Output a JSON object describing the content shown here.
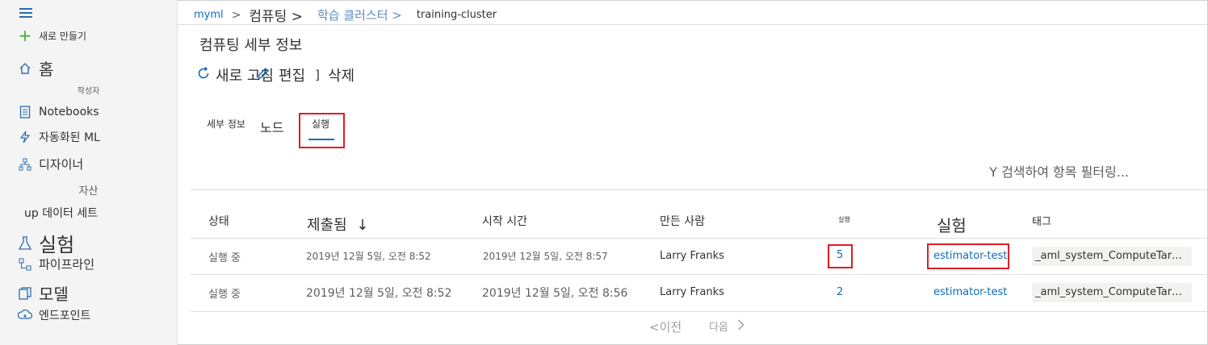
{
  "sidebar": {
    "create_label": "새로 만들기",
    "home_label": "홈",
    "section_author": "작성자",
    "notebooks_label": "Notebooks",
    "automl_label": "자동화된 ML",
    "designer_label": "디자이너",
    "section_assets": "자산",
    "datasets_label": "up 데이터 세트",
    "experiments_label": "실험",
    "pipelines_label": "파이프라인",
    "models_label": "모델",
    "endpoints_label": "엔드포인트"
  },
  "breadcrumb": {
    "item1": "myml",
    "item2": "컴퓨팅",
    "item2_suffix": ">",
    "item3": "학습 클러스터 >",
    "item4": "training-cluster"
  },
  "page": {
    "title": "컴퓨팅 세부 정보"
  },
  "toolbar": {
    "refresh_label": "새로 고침",
    "edit_label": "편집",
    "bracket": "]",
    "delete_label": "삭제"
  },
  "tabs": {
    "details": "세부 정보",
    "nodes": "노드",
    "runs": "실행"
  },
  "filter": {
    "text": "Y 검색하여 항목 필터링..."
  },
  "table": {
    "headers": {
      "status": "상태",
      "submitted": "제출됨",
      "sort_arrow": "↓",
      "start_time": "시작 시간",
      "created_by": "만든 사람",
      "run": "실행",
      "experiment": "실험",
      "tags": "태그"
    },
    "rows": [
      {
        "status": "실행 중",
        "submitted": "2019년 12월 5일, 오전 8:52",
        "start_time": "2019년 12월 5일, 오전 8:57",
        "created_by": "Larry Franks",
        "run": "5",
        "experiment": "estimator-test",
        "tags": "_aml_system_ComputeTarget..."
      },
      {
        "status": "실행 중",
        "submitted": "2019년 12월 5일, 오전 8:52",
        "start_time": "2019년 12월 5일, 오전 8:56",
        "created_by": "Larry Franks",
        "run": "2",
        "experiment": "estimator-test",
        "tags": "_aml_system_ComputeTarget..."
      }
    ]
  },
  "pager": {
    "prev": "<이전",
    "next": "다음"
  },
  "colors": {
    "accent": "#0f6cbd",
    "highlight": "#e31b23",
    "sidebar_bg": "#f4f4f4"
  }
}
